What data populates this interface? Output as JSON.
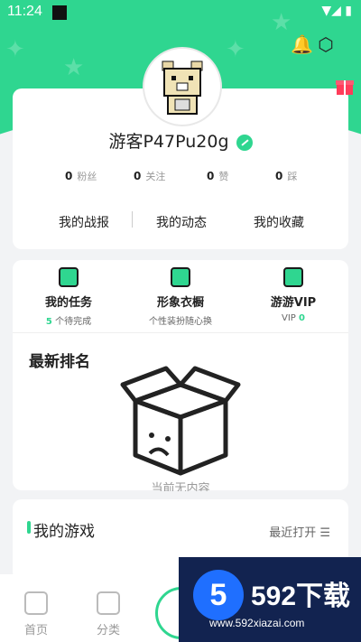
{
  "status_bar": {
    "time": "11:24"
  },
  "profile": {
    "username": "游客P47Pu20g",
    "stats": [
      {
        "value": "0",
        "label": "粉丝"
      },
      {
        "value": "0",
        "label": "关注"
      },
      {
        "value": "0",
        "label": "赞"
      },
      {
        "value": "0",
        "label": "踩"
      }
    ],
    "links": [
      "我的战报",
      "我的动态",
      "我的收藏"
    ]
  },
  "features": [
    {
      "title": "我的任务",
      "sub_prefix": "5",
      "sub": " 个待完成"
    },
    {
      "title": "形象衣橱",
      "sub_prefix": "",
      "sub": "个性装扮随心换"
    },
    {
      "title": "游游VIP",
      "sub_prefix": "VIP ",
      "sub": "0"
    }
  ],
  "ranking": {
    "title": "最新排名",
    "empty_text": "当前无内容"
  },
  "my_games": {
    "title": "我的游戏",
    "sort_label": "最近打开"
  },
  "tabbar": {
    "items": [
      "首页",
      "分类"
    ]
  },
  "watermark": {
    "number": "5",
    "brand": "592下载",
    "url": "www.592xiazai.com"
  },
  "colors": {
    "accent": "#2fd690"
  }
}
